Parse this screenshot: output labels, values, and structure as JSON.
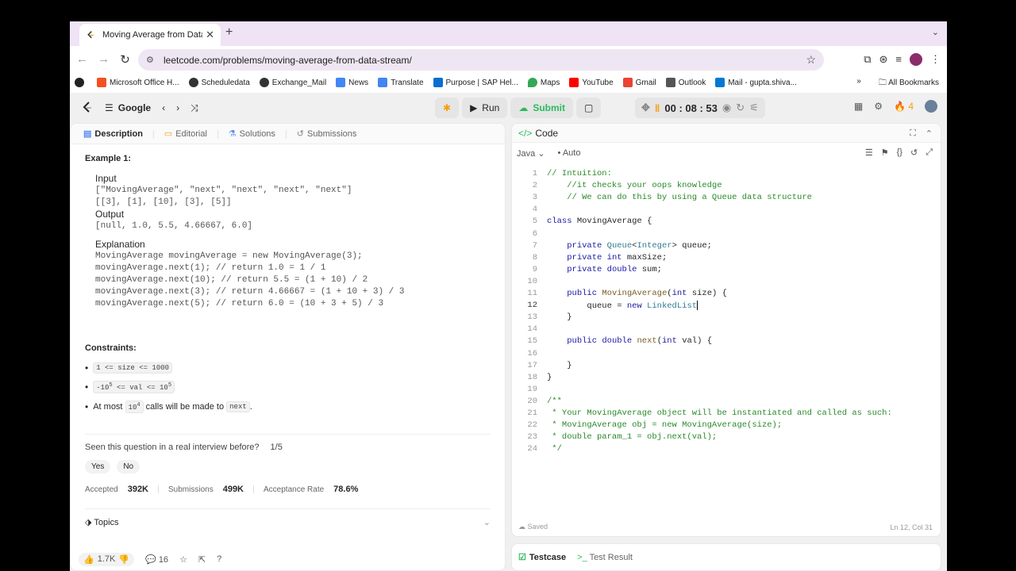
{
  "browser": {
    "tab_title": "Moving Average from Data St",
    "url": "leetcode.com/problems/moving-average-from-data-stream/",
    "bookmarks": [
      {
        "label": "Microsoft Office H...",
        "icon": "microsoft-icon"
      },
      {
        "label": "Scheduledata",
        "icon": "globe-icon"
      },
      {
        "label": "Exchange_Mail",
        "icon": "globe-icon"
      },
      {
        "label": "News",
        "icon": "news-icon"
      },
      {
        "label": "Translate",
        "icon": "translate-icon"
      },
      {
        "label": "Purpose | SAP Hel...",
        "icon": "sap-icon"
      },
      {
        "label": "Maps",
        "icon": "maps-icon"
      },
      {
        "label": "YouTube",
        "icon": "youtube-icon"
      },
      {
        "label": "Gmail",
        "icon": "gmail-icon"
      },
      {
        "label": "Outlook",
        "icon": "outlook-icon"
      },
      {
        "label": "Mail - gupta.shiva...",
        "icon": "outlook-mail-icon"
      }
    ],
    "all_bookmarks": "All Bookmarks",
    "more": "»"
  },
  "lc": {
    "list_name": "Google",
    "run_label": "Run",
    "submit_label": "Submit",
    "timer": "00 : 08 : 53",
    "streak": "4"
  },
  "left": {
    "tabs": [
      "Description",
      "Editorial",
      "Solutions",
      "Submissions"
    ],
    "example_title": "Example 1:",
    "input_label": "Input",
    "input_line1": "[\"MovingAverage\", \"next\", \"next\", \"next\", \"next\"]",
    "input_line2": "[[3], [1], [10], [3], [5]]",
    "output_label": "Output",
    "output_line": "[null, 1.0, 5.5, 4.66667, 6.0]",
    "explanation_label": "Explanation",
    "explanation_lines": [
      "MovingAverage movingAverage = new MovingAverage(3);",
      "movingAverage.next(1); // return 1.0 = 1 / 1",
      "movingAverage.next(10); // return 5.5 = (1 + 10) / 2",
      "movingAverage.next(3); // return 4.66667 = (1 + 10 + 3) / 3",
      "movingAverage.next(5); // return 6.0 = (10 + 3 + 5) / 3"
    ],
    "constraints_title": "Constraints:",
    "constraint1": "1 <= size <= 1000",
    "constraint2_a": "-10",
    "constraint2_sup1": "5",
    "constraint2_b": " <= val <= 10",
    "constraint2_sup2": "5",
    "constraint3_pre": "At most",
    "constraint3_code": "10",
    "constraint3_sup": "4",
    "constraint3_mid": "calls will be made to",
    "constraint3_code2": "next",
    "constraint3_post": ".",
    "seen_question": "Seen this question in a real interview before?",
    "seen_count": "1/5",
    "yes": "Yes",
    "no": "No",
    "accepted_label": "Accepted",
    "accepted_value": "392K",
    "submissions_label": "Submissions",
    "submissions_value": "499K",
    "rate_label": "Acceptance Rate",
    "rate_value": "78.6%",
    "topics_label": "Topics",
    "likes": "1.7K",
    "comments": "16"
  },
  "editor": {
    "title": "Code",
    "language": "Java",
    "mode": "Auto",
    "saved": "Saved",
    "position": "Ln 12, Col 31",
    "lines": [
      "// Intuition:",
      "    //it checks your oops knowledge",
      "    // We can do this by using a Queue data structure",
      "",
      "class MovingAverage {",
      "",
      "    private Queue<Integer> queue;",
      "    private int maxSize;",
      "    private double sum;",
      "",
      "    public MovingAverage(int size) {",
      "        queue = new LinkedList",
      "    }",
      "",
      "    public double next(int val) {",
      "",
      "    }",
      "}",
      "",
      "/**",
      " * Your MovingAverage object will be instantiated and called as such:",
      " * MovingAverage obj = new MovingAverage(size);",
      " * double param_1 = obj.next(val);",
      " */"
    ]
  },
  "bottom": {
    "testcase": "Testcase",
    "test_result": "Test Result"
  }
}
